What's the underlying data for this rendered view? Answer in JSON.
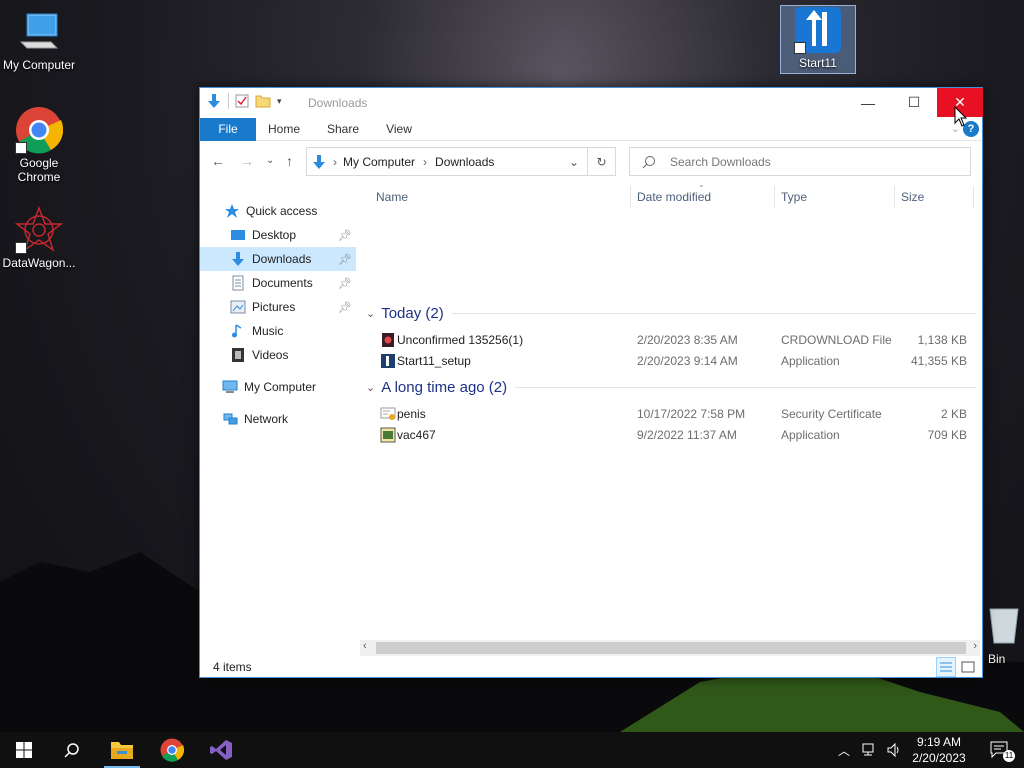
{
  "desktop": {
    "icons": [
      {
        "label": "My Computer"
      },
      {
        "label": "Google Chrome"
      },
      {
        "label": "DataWagon..."
      },
      {
        "label": "Start11"
      },
      {
        "label": "Bin"
      }
    ]
  },
  "window": {
    "title": "Downloads",
    "controls": {
      "minimize": "—",
      "maximize": "☐",
      "close": "✕"
    },
    "ribbon": {
      "tabs": [
        "File",
        "Home",
        "Share",
        "View"
      ],
      "help": "?"
    },
    "address": {
      "crumbs": [
        "My Computer",
        "Downloads"
      ]
    },
    "search": {
      "placeholder": "Search Downloads"
    },
    "nav_pane": {
      "quick_access": "Quick access",
      "items": [
        {
          "label": "Desktop",
          "icon": "desktop-icon",
          "pinned": true
        },
        {
          "label": "Downloads",
          "icon": "downloads-folder-icon",
          "pinned": true,
          "selected": true
        },
        {
          "label": "Documents",
          "icon": "documents-icon",
          "pinned": true
        },
        {
          "label": "Pictures",
          "icon": "pictures-icon",
          "pinned": true
        },
        {
          "label": "Music",
          "icon": "music-icon",
          "pinned": false
        },
        {
          "label": "Videos",
          "icon": "videos-icon",
          "pinned": false
        }
      ],
      "this_pc": "My Computer",
      "network": "Network"
    },
    "columns": {
      "name": "Name",
      "date": "Date modified",
      "type": "Type",
      "size": "Size"
    },
    "groups": [
      {
        "header": "Today (2)",
        "files": [
          {
            "name": "Unconfirmed 135256(1)",
            "date": "2/20/2023 8:35 AM",
            "type": "CRDOWNLOAD File",
            "size": "1,138 KB"
          },
          {
            "name": "Start11_setup",
            "date": "2/20/2023 9:14 AM",
            "type": "Application",
            "size": "41,355 KB"
          }
        ]
      },
      {
        "header": "A long time ago (2)",
        "files": [
          {
            "name": "penis",
            "date": "10/17/2022 7:58 PM",
            "type": "Security Certificate",
            "size": "2 KB"
          },
          {
            "name": "vac467",
            "date": "9/2/2022 11:37 AM",
            "type": "Application",
            "size": "709 KB"
          }
        ]
      }
    ],
    "status": "4 items"
  },
  "taskbar": {
    "clock_time": "9:19 AM",
    "clock_date": "2/20/2023",
    "notifications_count": "11"
  },
  "colors": {
    "accent": "#1979ca",
    "close_red": "#e81123",
    "selection": "#cce8ff",
    "group_blue": "#1e3287"
  }
}
